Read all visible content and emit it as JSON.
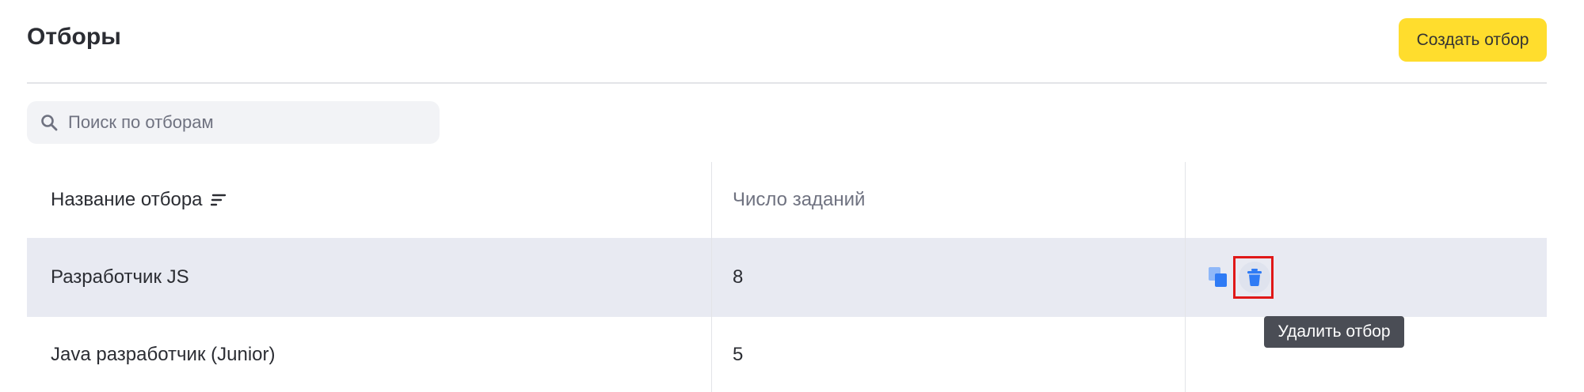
{
  "header": {
    "title": "Отборы",
    "create_button_label": "Создать отбор"
  },
  "search": {
    "placeholder": "Поиск по отборам",
    "value": ""
  },
  "table": {
    "columns": {
      "name": "Название отбора",
      "count": "Число заданий",
      "actions": ""
    },
    "rows": [
      {
        "name": "Разработчик JS",
        "count": "8"
      },
      {
        "name": "Java разработчик (Junior)",
        "count": "5"
      }
    ]
  },
  "tooltip": {
    "text": "Удалить отбор"
  },
  "colors": {
    "accent_button": "#ffdd2d",
    "hover_row": "#e8eaf2",
    "icon_blue": "#2f7bf5",
    "highlight_box": "#e01818",
    "tooltip_bg": "#4a4d55"
  },
  "icons": {
    "search": "search-icon",
    "sort": "sort-icon",
    "copy": "copy-icon",
    "delete": "trash-icon"
  }
}
